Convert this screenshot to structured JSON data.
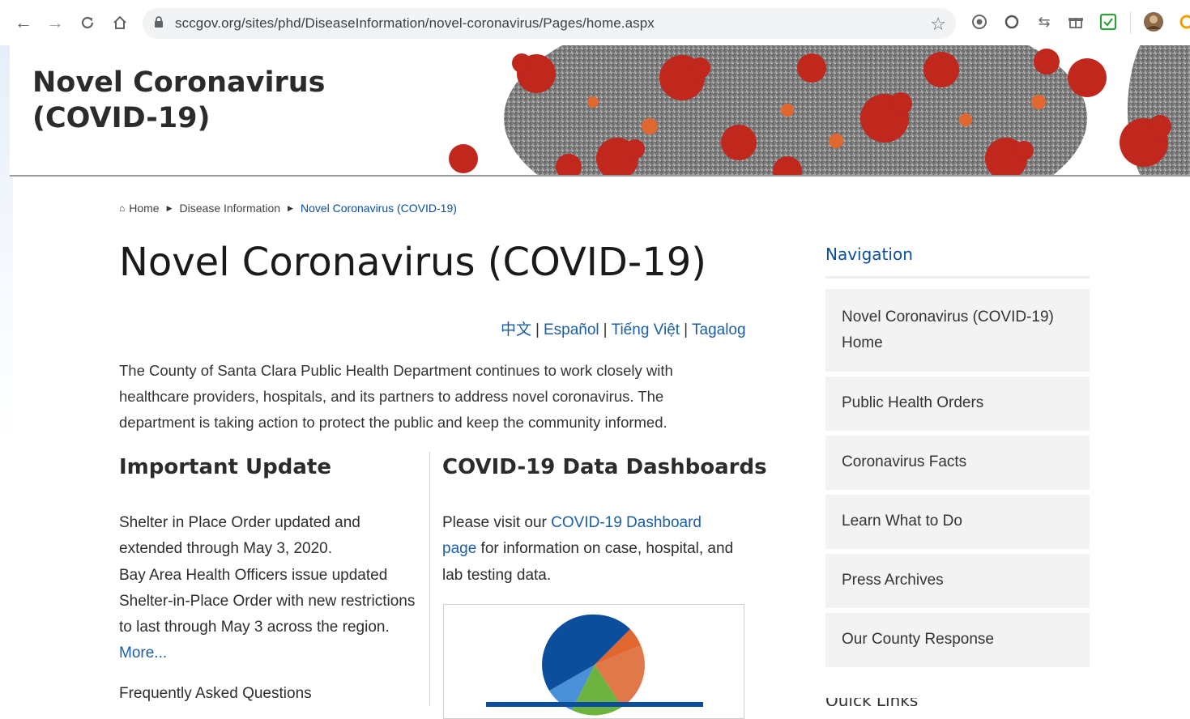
{
  "browser": {
    "url": "sccgov.org/sites/phd/DiseaseInformation/novel-coronavirus/Pages/home.aspx",
    "nav": {
      "back_icon": "arrow-left-icon",
      "forward_icon": "arrow-right-icon",
      "reload_icon": "reload-icon",
      "home_icon": "home-icon"
    },
    "extensions": [
      "extension-icon",
      "circle-extension-icon",
      "arrows-extension-icon",
      "gift-extension-icon",
      "green-extension-icon",
      "profile-avatar-icon",
      "orange-extension-icon"
    ]
  },
  "banner": {
    "title_line1": "Novel Coronavirus",
    "title_line2": "(COVID-19)"
  },
  "breadcrumb": {
    "items": [
      "Home",
      "Disease Information",
      "Novel Coronavirus (COVID-19)"
    ]
  },
  "main": {
    "title": "Novel Coronavirus (COVID-19)",
    "languages": [
      "中文",
      "Español",
      "Tiếng Việt",
      "Tagalog"
    ],
    "intro": "The County of Santa Clara Public Health Department continues to work closely with healthcare providers, hospitals, and its partners to address novel coronavirus. The department is taking action to protect the public and keep the community informed.",
    "important_update": {
      "heading": "Important Update",
      "line1": "Shelter in Place Order updated and extended through May 3, 2020.",
      "line2": "Bay Area Health Officers issue updated Shelter-in-Place Order with new restrictions to last through May 3 across the region.",
      "more_link": "More..."
    },
    "faq_heading": "Frequently Asked Questions",
    "dashboards": {
      "heading": "COVID-19 Data Dashboards",
      "text_before": "Please visit our ",
      "link": "COVID-19 Dashboard page",
      "text_after": " for information on case, hospital, and lab testing data."
    }
  },
  "sidebar": {
    "heading": "Navigation",
    "items": [
      "Novel Coronavirus (COVID-19) Home",
      "Public Health Orders",
      "Coronavirus Facts",
      "Learn What to Do",
      "Press Archives",
      "Our County Response"
    ],
    "next_heading": "Quick Links"
  },
  "colors": {
    "link": "#1a5ea8",
    "nav_heading": "#0b4f9c",
    "nav_item_bg": "#f3f3f3",
    "virus_red": "#c0271d",
    "virus_gray": "#8a8a8a"
  }
}
